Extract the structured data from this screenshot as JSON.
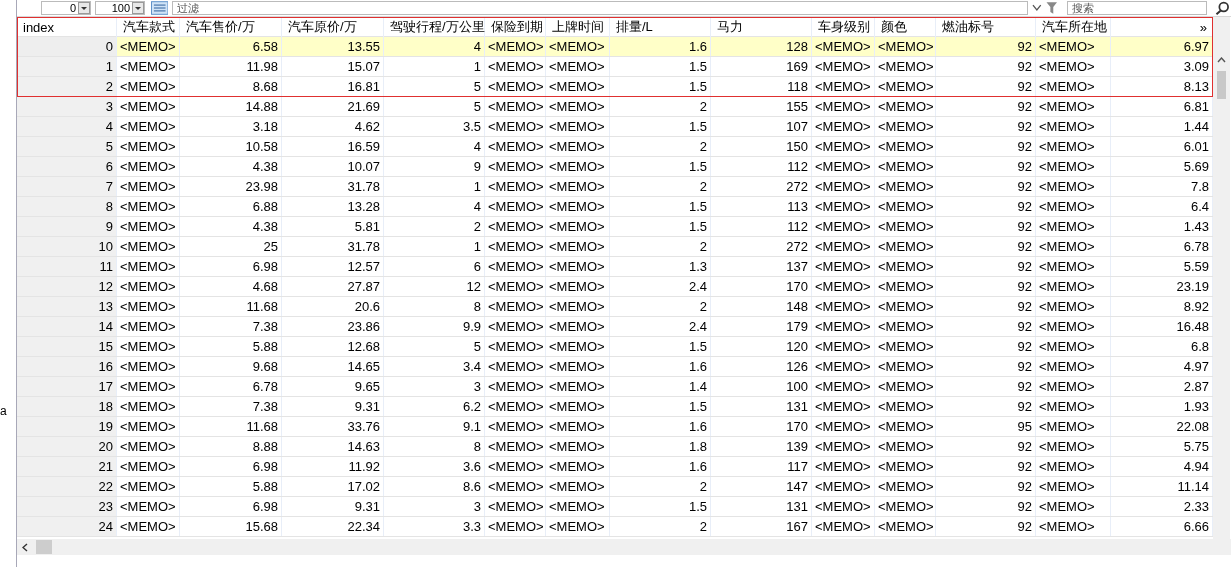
{
  "toolbar": {
    "start_value": "0",
    "count_value": "100",
    "filter": {
      "placeholder": "过滤"
    },
    "search": {
      "placeholder": "搜索"
    }
  },
  "side_panel": {
    "label": "a"
  },
  "table": {
    "columns": [
      {
        "label": "index",
        "kind": "number"
      },
      {
        "label": "汽车款式",
        "kind": "text"
      },
      {
        "label": "汽车售价/万",
        "kind": "number"
      },
      {
        "label": "汽车原价/万",
        "kind": "number"
      },
      {
        "label": "驾驶行程/万公里",
        "kind": "number"
      },
      {
        "label": "保险到期",
        "kind": "text"
      },
      {
        "label": "上牌时间",
        "kind": "text"
      },
      {
        "label": "排量/L",
        "kind": "number"
      },
      {
        "label": "马力",
        "kind": "number"
      },
      {
        "label": "车身级别",
        "kind": "text"
      },
      {
        "label": "颜色",
        "kind": "text"
      },
      {
        "label": "燃油标号",
        "kind": "number"
      },
      {
        "label": "汽车所在地",
        "kind": "text"
      },
      {
        "label": "»",
        "kind": "number"
      }
    ],
    "rows": [
      {
        "selected": true,
        "cells": [
          "0",
          "<MEMO>",
          "6.58",
          "13.55",
          "4",
          "<MEMO>",
          "<MEMO>",
          "1.6",
          "128",
          "<MEMO>",
          "<MEMO>",
          "92",
          "<MEMO>",
          "6.97"
        ]
      },
      {
        "selected": false,
        "cells": [
          "1",
          "<MEMO>",
          "11.98",
          "15.07",
          "1",
          "<MEMO>",
          "<MEMO>",
          "1.5",
          "169",
          "<MEMO>",
          "<MEMO>",
          "92",
          "<MEMO>",
          "3.09"
        ]
      },
      {
        "selected": false,
        "cells": [
          "2",
          "<MEMO>",
          "8.68",
          "16.81",
          "5",
          "<MEMO>",
          "<MEMO>",
          "1.5",
          "118",
          "<MEMO>",
          "<MEMO>",
          "92",
          "<MEMO>",
          "8.13"
        ]
      },
      {
        "selected": false,
        "cells": [
          "3",
          "<MEMO>",
          "14.88",
          "21.69",
          "5",
          "<MEMO>",
          "<MEMO>",
          "2",
          "155",
          "<MEMO>",
          "<MEMO>",
          "92",
          "<MEMO>",
          "6.81"
        ]
      },
      {
        "selected": false,
        "cells": [
          "4",
          "<MEMO>",
          "3.18",
          "4.62",
          "3.5",
          "<MEMO>",
          "<MEMO>",
          "1.5",
          "107",
          "<MEMO>",
          "<MEMO>",
          "92",
          "<MEMO>",
          "1.44"
        ]
      },
      {
        "selected": false,
        "cells": [
          "5",
          "<MEMO>",
          "10.58",
          "16.59",
          "4",
          "<MEMO>",
          "<MEMO>",
          "2",
          "150",
          "<MEMO>",
          "<MEMO>",
          "92",
          "<MEMO>",
          "6.01"
        ]
      },
      {
        "selected": false,
        "cells": [
          "6",
          "<MEMO>",
          "4.38",
          "10.07",
          "9",
          "<MEMO>",
          "<MEMO>",
          "1.5",
          "112",
          "<MEMO>",
          "<MEMO>",
          "92",
          "<MEMO>",
          "5.69"
        ]
      },
      {
        "selected": false,
        "cells": [
          "7",
          "<MEMO>",
          "23.98",
          "31.78",
          "1",
          "<MEMO>",
          "<MEMO>",
          "2",
          "272",
          "<MEMO>",
          "<MEMO>",
          "92",
          "<MEMO>",
          "7.8"
        ]
      },
      {
        "selected": false,
        "cells": [
          "8",
          "<MEMO>",
          "6.88",
          "13.28",
          "4",
          "<MEMO>",
          "<MEMO>",
          "1.5",
          "113",
          "<MEMO>",
          "<MEMO>",
          "92",
          "<MEMO>",
          "6.4"
        ]
      },
      {
        "selected": false,
        "cells": [
          "9",
          "<MEMO>",
          "4.38",
          "5.81",
          "2",
          "<MEMO>",
          "<MEMO>",
          "1.5",
          "112",
          "<MEMO>",
          "<MEMO>",
          "92",
          "<MEMO>",
          "1.43"
        ]
      },
      {
        "selected": false,
        "cells": [
          "10",
          "<MEMO>",
          "25",
          "31.78",
          "1",
          "<MEMO>",
          "<MEMO>",
          "2",
          "272",
          "<MEMO>",
          "<MEMO>",
          "92",
          "<MEMO>",
          "6.78"
        ]
      },
      {
        "selected": false,
        "cells": [
          "11",
          "<MEMO>",
          "6.98",
          "12.57",
          "6",
          "<MEMO>",
          "<MEMO>",
          "1.3",
          "137",
          "<MEMO>",
          "<MEMO>",
          "92",
          "<MEMO>",
          "5.59"
        ]
      },
      {
        "selected": false,
        "cells": [
          "12",
          "<MEMO>",
          "4.68",
          "27.87",
          "12",
          "<MEMO>",
          "<MEMO>",
          "2.4",
          "170",
          "<MEMO>",
          "<MEMO>",
          "92",
          "<MEMO>",
          "23.19"
        ]
      },
      {
        "selected": false,
        "cells": [
          "13",
          "<MEMO>",
          "11.68",
          "20.6",
          "8",
          "<MEMO>",
          "<MEMO>",
          "2",
          "148",
          "<MEMO>",
          "<MEMO>",
          "92",
          "<MEMO>",
          "8.92"
        ]
      },
      {
        "selected": false,
        "cells": [
          "14",
          "<MEMO>",
          "7.38",
          "23.86",
          "9.9",
          "<MEMO>",
          "<MEMO>",
          "2.4",
          "179",
          "<MEMO>",
          "<MEMO>",
          "92",
          "<MEMO>",
          "16.48"
        ]
      },
      {
        "selected": false,
        "cells": [
          "15",
          "<MEMO>",
          "5.88",
          "12.68",
          "5",
          "<MEMO>",
          "<MEMO>",
          "1.5",
          "120",
          "<MEMO>",
          "<MEMO>",
          "92",
          "<MEMO>",
          "6.8"
        ]
      },
      {
        "selected": false,
        "cells": [
          "16",
          "<MEMO>",
          "9.68",
          "14.65",
          "3.4",
          "<MEMO>",
          "<MEMO>",
          "1.6",
          "126",
          "<MEMO>",
          "<MEMO>",
          "92",
          "<MEMO>",
          "4.97"
        ]
      },
      {
        "selected": false,
        "cells": [
          "17",
          "<MEMO>",
          "6.78",
          "9.65",
          "3",
          "<MEMO>",
          "<MEMO>",
          "1.4",
          "100",
          "<MEMO>",
          "<MEMO>",
          "92",
          "<MEMO>",
          "2.87"
        ]
      },
      {
        "selected": false,
        "cells": [
          "18",
          "<MEMO>",
          "7.38",
          "9.31",
          "6.2",
          "<MEMO>",
          "<MEMO>",
          "1.5",
          "131",
          "<MEMO>",
          "<MEMO>",
          "92",
          "<MEMO>",
          "1.93"
        ]
      },
      {
        "selected": false,
        "cells": [
          "19",
          "<MEMO>",
          "11.68",
          "33.76",
          "9.1",
          "<MEMO>",
          "<MEMO>",
          "1.6",
          "170",
          "<MEMO>",
          "<MEMO>",
          "95",
          "<MEMO>",
          "22.08"
        ]
      },
      {
        "selected": false,
        "cells": [
          "20",
          "<MEMO>",
          "8.88",
          "14.63",
          "8",
          "<MEMO>",
          "<MEMO>",
          "1.8",
          "139",
          "<MEMO>",
          "<MEMO>",
          "92",
          "<MEMO>",
          "5.75"
        ]
      },
      {
        "selected": false,
        "cells": [
          "21",
          "<MEMO>",
          "6.98",
          "11.92",
          "3.6",
          "<MEMO>",
          "<MEMO>",
          "1.6",
          "117",
          "<MEMO>",
          "<MEMO>",
          "92",
          "<MEMO>",
          "4.94"
        ]
      },
      {
        "selected": false,
        "cells": [
          "22",
          "<MEMO>",
          "5.88",
          "17.02",
          "8.6",
          "<MEMO>",
          "<MEMO>",
          "2",
          "147",
          "<MEMO>",
          "<MEMO>",
          "92",
          "<MEMO>",
          "11.14"
        ]
      },
      {
        "selected": false,
        "cells": [
          "23",
          "<MEMO>",
          "6.98",
          "9.31",
          "3",
          "<MEMO>",
          "<MEMO>",
          "1.5",
          "131",
          "<MEMO>",
          "<MEMO>",
          "92",
          "<MEMO>",
          "2.33"
        ]
      },
      {
        "selected": false,
        "cells": [
          "24",
          "<MEMO>",
          "15.68",
          "22.34",
          "3.3",
          "<MEMO>",
          "<MEMO>",
          "2",
          "167",
          "<MEMO>",
          "<MEMO>",
          "92",
          "<MEMO>",
          "6.66"
        ]
      }
    ]
  }
}
